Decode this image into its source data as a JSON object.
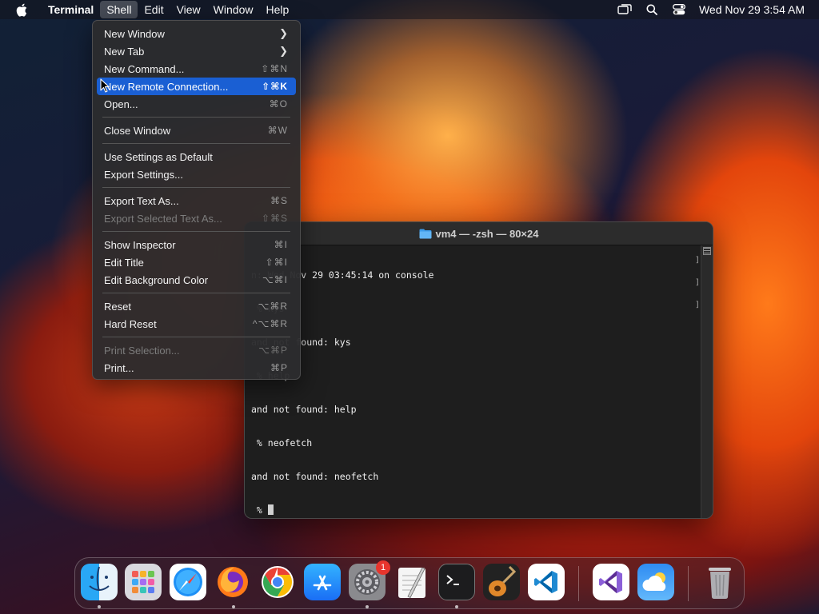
{
  "menubar": {
    "app_name": "Terminal",
    "menus": [
      "Shell",
      "Edit",
      "View",
      "Window",
      "Help"
    ],
    "active_menu": "Shell",
    "clock": "Wed Nov 29  3:54 AM"
  },
  "shell_menu": {
    "items": [
      {
        "label": "New Window",
        "shortcut": "",
        "submenu": true
      },
      {
        "label": "New Tab",
        "shortcut": "",
        "submenu": true
      },
      {
        "label": "New Command...",
        "shortcut": "⇧⌘N"
      },
      {
        "label": "New Remote Connection...",
        "shortcut": "⇧⌘K",
        "selected": true
      },
      {
        "label": "Open...",
        "shortcut": "⌘O"
      },
      {
        "label": "Close Window",
        "shortcut": "⌘W"
      },
      {
        "label": "Use Settings as Default",
        "shortcut": ""
      },
      {
        "label": "Export Settings...",
        "shortcut": ""
      },
      {
        "label": "Export Text As...",
        "shortcut": "⌘S"
      },
      {
        "label": "Export Selected Text As...",
        "shortcut": "⇧⌘S",
        "disabled": true
      },
      {
        "label": "Show Inspector",
        "shortcut": "⌘I"
      },
      {
        "label": "Edit Title",
        "shortcut": "⇧⌘I"
      },
      {
        "label": "Edit Background Color",
        "shortcut": "⌥⌘I"
      },
      {
        "label": "Reset",
        "shortcut": "⌥⌘R"
      },
      {
        "label": "Hard Reset",
        "shortcut": "^⌥⌘R"
      },
      {
        "label": "Print Selection...",
        "shortcut": "⌥⌘P",
        "disabled": true
      },
      {
        "label": "Print...",
        "shortcut": "⌘P"
      }
    ]
  },
  "terminal": {
    "title": "vm4 — -zsh — 80×24",
    "lines": [
      "n: Wed Nov 29 03:45:14 on console",
      " % kys",
      "and not found: kys",
      " % help",
      "and not found: help",
      " % neofetch",
      "and not found: neofetch",
      " % "
    ]
  },
  "dock": {
    "badge_count": "1",
    "apps": [
      "finder-icon",
      "launchpad-icon",
      "safari-icon",
      "firefox-icon",
      "chrome-icon",
      "app-store-icon",
      "system-settings-icon",
      "textedit-icon",
      "terminal-icon",
      "garageband-icon",
      "vscode-icon",
      "visual-studio-icon",
      "weather-icon",
      "trash-icon"
    ]
  }
}
